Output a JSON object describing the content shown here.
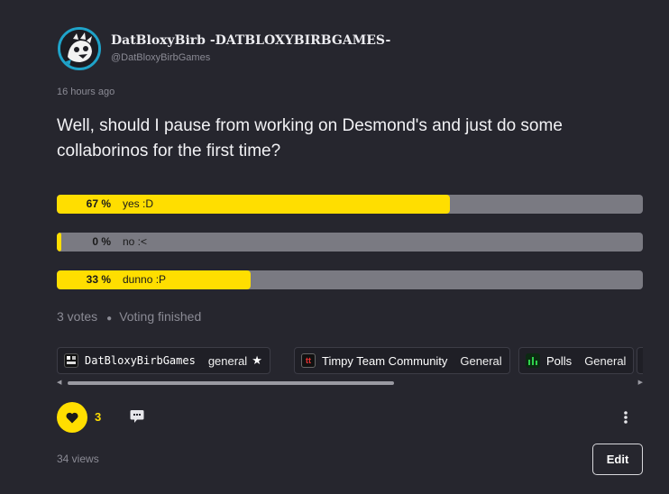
{
  "author": {
    "name": "DatBloxyBirb -DATBLOXYBIRBGAMES-",
    "handle": "@DatBloxyBirbGames",
    "avatar_icon": "bird-avatar-icon"
  },
  "post": {
    "timestamp": "16 hours ago",
    "question": "Well, should I pause from working on Desmond's and just do some collaborinos for the first time?"
  },
  "poll": {
    "options": [
      {
        "percent_label": "67 %",
        "label": "yes :D",
        "fraction": 0.67
      },
      {
        "percent_label": "0 %",
        "label": "no :<",
        "fraction": 0.0
      },
      {
        "percent_label": "33 %",
        "label": "dunno :P",
        "fraction": 0.33
      }
    ],
    "votes": "3 votes",
    "status": "Voting finished",
    "fill_color": "#ffde00",
    "track_color": "#7a7a82"
  },
  "communities": [
    {
      "name": "DatBloxyBirbGames",
      "channel": "general",
      "icon": "dbb-community-icon",
      "starred": true
    },
    {
      "name": "Timpy Team Community",
      "channel": "General",
      "icon": "timpy-community-icon",
      "starred": false
    },
    {
      "name": "Polls",
      "channel": "General",
      "icon": "polls-community-icon",
      "starred": false
    }
  ],
  "actions": {
    "like_count": "3",
    "like_icon": "heart-icon",
    "comment_icon": "comment-icon",
    "more_icon": "more-vertical-icon",
    "views": "34 views",
    "edit_label": "Edit",
    "accent_color": "#ffde00"
  }
}
